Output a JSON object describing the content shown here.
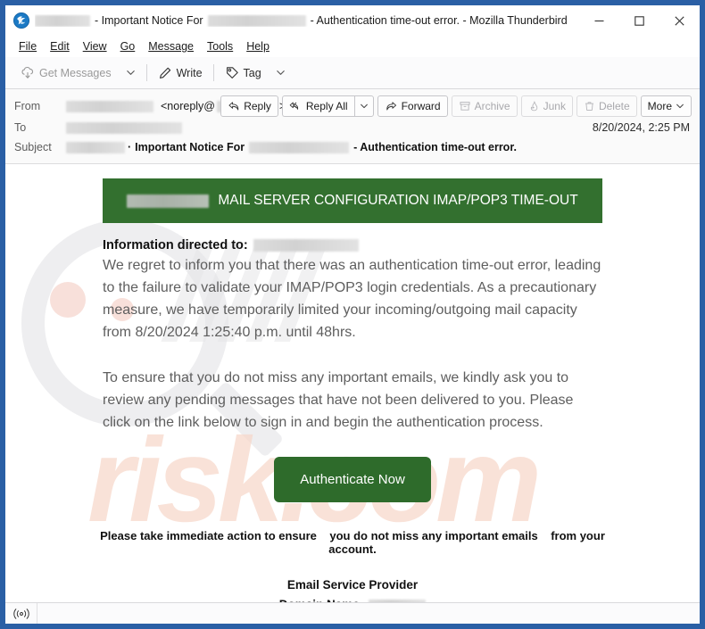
{
  "window": {
    "title_prefix_redacted": true,
    "title_middle": "- Important Notice For",
    "title_suffix": "- Authentication time-out error. - Mozilla Thunderbird",
    "app_name": "Mozilla Thunderbird",
    "logo_icon": "thunderbird-logo-icon",
    "controls": {
      "minimize": "—",
      "maximize": "□",
      "close": "✕"
    },
    "frame_color": "#2a5fa5"
  },
  "menubar": {
    "items": [
      {
        "label": "File",
        "accesskey": "F"
      },
      {
        "label": "Edit",
        "accesskey": "E"
      },
      {
        "label": "View",
        "accesskey": "V"
      },
      {
        "label": "Go",
        "accesskey": "G"
      },
      {
        "label": "Message",
        "accesskey": "M"
      },
      {
        "label": "Tools",
        "accesskey": "T"
      },
      {
        "label": "Help",
        "accesskey": "H"
      }
    ]
  },
  "toolbar": {
    "get_messages_label": "Get Messages",
    "get_messages_icon": "download-cloud-icon",
    "get_messages_disabled": true,
    "dropdown_icon": "chevron-down-icon",
    "write_label": "Write",
    "write_icon": "pencil-icon",
    "tag_label": "Tag",
    "tag_icon": "tag-icon"
  },
  "message_header": {
    "from_label": "From",
    "from_name_redacted": true,
    "from_email_prefix": "<noreply@",
    "from_email_suffix": ">",
    "from_addressbook_icon": "contact-card-icon",
    "to_label": "To",
    "to_value_redacted": true,
    "subject_label": "Subject",
    "subject_sep": "·",
    "subject_bold_1": "Important Notice For",
    "subject_bold_2": "- Authentication time-out error.",
    "date": "8/20/2024, 2:25 PM",
    "actions": [
      {
        "label": "Reply",
        "icon": "reply-arrow-icon",
        "disabled": false
      },
      {
        "label": "Reply All",
        "icon": "reply-all-arrow-icon",
        "disabled": false
      },
      {
        "label": "",
        "icon": "chevron-down-icon",
        "disabled": false
      },
      {
        "label": "Forward",
        "icon": "forward-arrow-icon",
        "disabled": false
      },
      {
        "label": "Archive",
        "icon": "archive-box-icon",
        "disabled": true
      },
      {
        "label": "Junk",
        "icon": "junk-flame-icon",
        "disabled": true
      },
      {
        "label": "Delete",
        "icon": "trash-can-icon",
        "disabled": true
      },
      {
        "label": "More",
        "icon": "chevron-down-icon",
        "disabled": false
      }
    ]
  },
  "email": {
    "banner": {
      "brand_redacted": true,
      "text": "MAIL SERVER CONFIGURATION IMAP/POP3 TIME-OUT",
      "background_color": "#33702f",
      "text_color": "#ffffff"
    },
    "info_directed_label": "Information directed to:",
    "info_directed_value_redacted": true,
    "paragraph_1": "We regret to inform you that there was an authentication time-out error, leading to the failure to validate your IMAP/POP3 login credentials. As a precautionary measure, we have temporarily limited your incoming/outgoing mail capacity from 8/20/2024 1:25:40 p.m. until 48hrs.",
    "paragraph_2": "To ensure that you do not miss any important emails, we kindly ask you to review any pending messages that have not been delivered to you. Please click on the link below to sign in and begin the authentication process.",
    "cta_label": "Authenticate Now",
    "cta_color": "#2e6b2b",
    "footer_line_part_1": "Please take immediate action to ensure",
    "footer_line_part_2": "you do not miss any important emails",
    "footer_line_part_3": "from your account.",
    "provider_label": "Email Service Provider",
    "domain_label": "Domain Name:",
    "domain_value_redacted": true
  },
  "watermark": {
    "text": "risk.com",
    "color": "#f7d6c8"
  },
  "statusbar": {
    "connection_icon": "broadcast-signal-icon",
    "connection_glyph": "((○))",
    "text": ""
  }
}
